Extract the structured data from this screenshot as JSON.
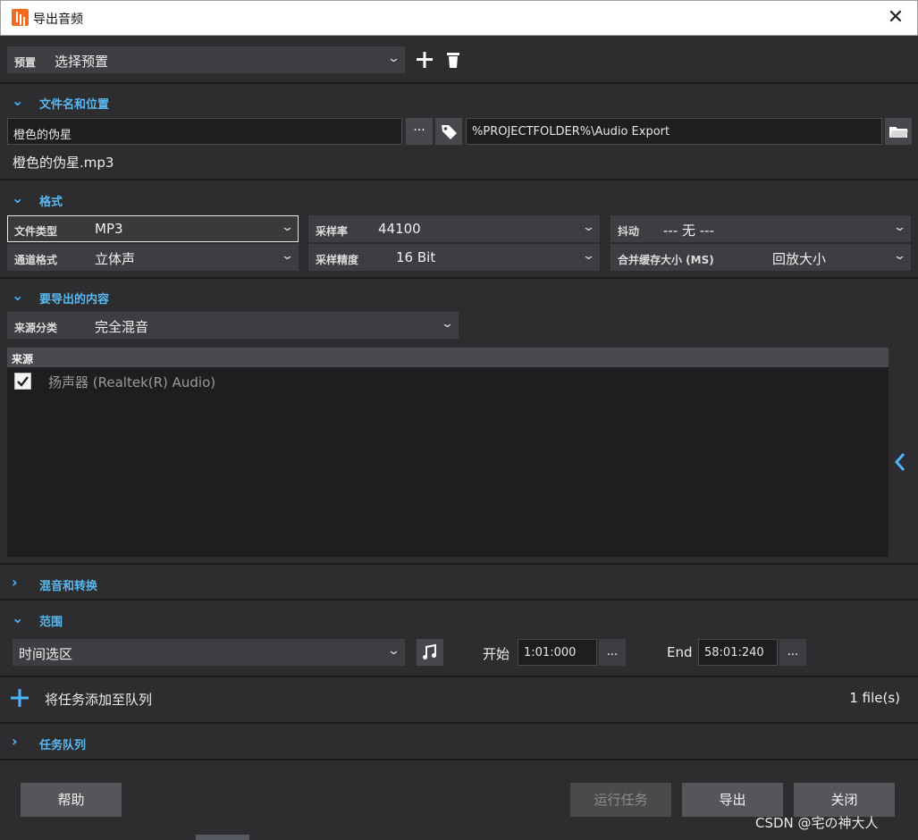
{
  "window": {
    "title": "导出音频",
    "close_glyph": "✕"
  },
  "preset": {
    "label": "预置",
    "value": "选择预置",
    "add_glyph": "+",
    "delete_glyph": "🗑"
  },
  "filename_section": {
    "title": "文件名和位置",
    "name_value": "橙色的伪星",
    "name_more": "···",
    "path_value": "%PROJECTFOLDER%\\Audio Export",
    "result_name": "橙色的伪星.mp3"
  },
  "format_section": {
    "title": "格式",
    "file_type": {
      "label": "文件类型",
      "value": "MP3"
    },
    "sample_rate": {
      "label": "采样率",
      "value": "44100"
    },
    "dither": {
      "label": "抖动",
      "value": "--- 无 ---"
    },
    "channel": {
      "label": "通道格式",
      "value": "立体声"
    },
    "bit_depth": {
      "label": "采样精度",
      "value": "16 Bit"
    },
    "buffer": {
      "label": "合并缓存大小 (MS)",
      "value": "回放大小"
    }
  },
  "content_section": {
    "title": "要导出的内容",
    "source_type": {
      "label": "来源分类",
      "value": "完全混音"
    },
    "list_header": "来源",
    "sources": [
      {
        "label": "扬声器 (Realtek(R) Audio)",
        "checked": true
      }
    ]
  },
  "mix_section": {
    "title": "混音和转换"
  },
  "range_section": {
    "title": "范围",
    "mode": "时间选区",
    "start_label": "开始",
    "start_value": "1:01:000",
    "end_label": "End",
    "end_value": "58:01:240",
    "more": "..."
  },
  "queue_add": {
    "label": "将任务添加至队列",
    "count": "1 file(s)"
  },
  "queue_section": {
    "title": "任务队列"
  },
  "footer": {
    "help": "帮助",
    "run": "运行任务",
    "export": "导出",
    "close": "关闭"
  },
  "watermark": "CSDN @宅の神大人",
  "colors": {
    "accent": "#4db4ff",
    "background": "#2d2d30",
    "panel": "#3e3e42",
    "app_icon": "#f26b1d"
  }
}
